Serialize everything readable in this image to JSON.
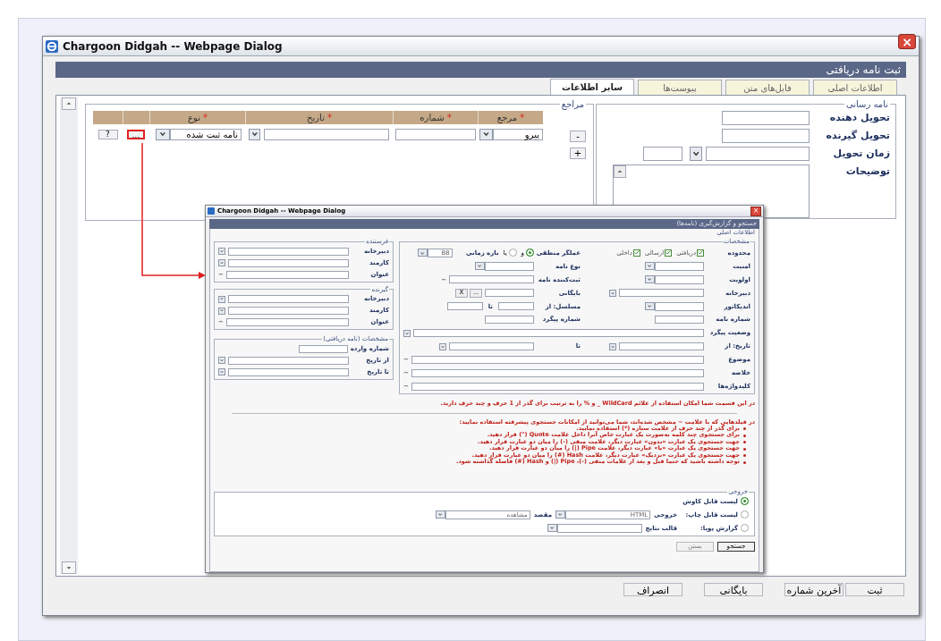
{
  "window": {
    "title": "Chargoon Didgah -- Webpage Dialog",
    "close": "×"
  },
  "header": "ثبت نامه دریافتی",
  "tabs": [
    {
      "label": "اطلاعات اصلی",
      "selected": false
    },
    {
      "label": "فایل‌های متن",
      "selected": false
    },
    {
      "label": "پیوست‌ها",
      "selected": false
    },
    {
      "label": "سایر اطلاعات",
      "selected": true
    }
  ],
  "delivery": {
    "legend": "نامه رسانی",
    "fields": [
      {
        "label": "تحویل دهنده",
        "kind": "text"
      },
      {
        "label": "تحویل گیرنده",
        "kind": "text"
      },
      {
        "label": "زمان تحویل",
        "kind": "datetime"
      },
      {
        "label": "توضیحات",
        "kind": "textarea"
      }
    ]
  },
  "references": {
    "legend": "مراجع",
    "remove": "-",
    "add": "+",
    "columns": [
      {
        "label": "مرجع",
        "mark": "*"
      },
      {
        "label": "شماره",
        "mark": "*"
      },
      {
        "label": "تاریخ",
        "mark": "*"
      },
      {
        "label": "نوع",
        "mark": "*"
      }
    ],
    "rows": [
      {
        "ref": "پیرو",
        "type": "نامه ثبت شده",
        "browse": "...",
        "browse_highlighted": true,
        "help": "?"
      }
    ]
  },
  "buttons": [
    "ثبت",
    "آخرین شماره",
    "بایگانی",
    "انصراف"
  ],
  "search_dialog": {
    "title": "Chargoon Didgah -- Webpage Dialog",
    "header": "جستجو و گزارش‌گیری (نامه‌ها)",
    "section": "اطلاعات اصلی",
    "main": {
      "legend": "مشخصات",
      "rows": [
        {
          "cells": [
            {
              "label": "محدوده",
              "kind": "checks",
              "options": [
                {
                  "label": "دریافتی",
                  "checked": true
                },
                {
                  "label": "ارسالی",
                  "checked": true
                },
                {
                  "label": "داخلی",
                  "checked": true
                }
              ]
            },
            {
              "label": "عملگر منطقی",
              "kind": "radios",
              "options": [
                {
                  "label": "و",
                  "selected": true
                },
                {
                  "label": "یا",
                  "selected": false
                }
              ]
            },
            {
              "label": "بازه زمانی",
              "kind": "select",
              "value": "88"
            }
          ]
        },
        {
          "cells": [
            {
              "label": "امنیت",
              "kind": "select"
            },
            {
              "label": "نوع نامه",
              "kind": "select"
            }
          ]
        },
        {
          "cells": [
            {
              "label": "اولویت",
              "kind": "select"
            },
            {
              "label": "ثبت‌کننده نامه",
              "kind": "wild",
              "wildcard": "~"
            }
          ]
        },
        {
          "cells": [
            {
              "label": "دبیرخانه",
              "kind": "combo"
            },
            {
              "label": "بایگانی",
              "kind": "archive",
              "browse": "...",
              "clear": "X"
            }
          ]
        },
        {
          "cells": [
            {
              "label": "اندیکاتور",
              "kind": "select"
            },
            {
              "label": "مسلسل: از",
              "kind": "range",
              "to": "تا"
            }
          ]
        },
        {
          "cells": [
            {
              "label": "شماره نامه",
              "kind": "text"
            },
            {
              "label": "شماره پیگرد",
              "kind": "text"
            }
          ]
        },
        {
          "cells": [
            {
              "label": "وضعیت پیگرد",
              "kind": "combo"
            }
          ]
        },
        {
          "cells": [
            {
              "label": "تاریخ: از",
              "kind": "combo"
            },
            {
              "label": "تا",
              "kind": "combo"
            }
          ]
        },
        {
          "cells": [
            {
              "label": "موضوع",
              "kind": "wild",
              "wildcard": "~"
            }
          ]
        },
        {
          "cells": [
            {
              "label": "خلاصه",
              "kind": "wild",
              "wildcard": "~"
            }
          ]
        },
        {
          "cells": [
            {
              "label": "کلیدواژه‌ها",
              "kind": "wild",
              "wildcard": "~"
            }
          ]
        }
      ]
    },
    "side": [
      {
        "legend": "فرستنده",
        "fields": [
          {
            "label": "دبیرخانه",
            "kind": "combo"
          },
          {
            "label": "کارمند",
            "kind": "combo"
          },
          {
            "label": "عنوان",
            "kind": "wild",
            "wildcard": "~"
          }
        ]
      },
      {
        "legend": "گیرنده",
        "fields": [
          {
            "label": "دبیرخانه",
            "kind": "combo"
          },
          {
            "label": "کارمند",
            "kind": "combo"
          },
          {
            "label": "عنوان",
            "kind": "wild",
            "wildcard": "~"
          }
        ]
      },
      {
        "legend": "مشخصات (نامه دریافتی)",
        "fields": [
          {
            "label": "شماره وارده",
            "kind": "text"
          },
          {
            "label": "از تاریخ",
            "kind": "combo"
          },
          {
            "label": "تا تاریخ",
            "kind": "combo"
          }
        ]
      }
    ],
    "wildcard_note": "در این قسمت شما امکان استفاده از علائم WildCard _ و % را به ترتیب برای گذر از 1 حرف و چند حرف دارید.",
    "help_intro": "در فیلدهایی که با علامت ~ مشخص شده‌اند، شما می‌توانید از امکانات جستجوی پیشرفته استفاده نمایید:",
    "help_items": [
      "برای گذر از چند حرف از علامت ستاره (*) استفاده نمایید.",
      "برای جستجوی چند کلمه به‌صورت یک عبارت خاص آنرا داخل علامت Quote (\") قرار دهید.",
      "جهت جستجوی یک عبارت «بدون» عبارت دیگر، علامت منفی (-) را میان دو عبارت قرار دهید.",
      "جهت جستجوی یک عبارت «یا» عبارت دیگر، علامت Pipe (|) را میان دو عبارت قرار دهید.",
      "جهت جستجوی یک عبارت «نزدیک» عبارت دیگر، علامت Hash (#) را میان دو عبارت قرار دهید.",
      "توجه داشته باشید که حتما قبل و بعد از علامات منفی (-)، Pipe (|) و Hash (#) فاصله گذاشته شود."
    ],
    "output": {
      "legend": "خروجی",
      "options": [
        {
          "label": "لیست قابل کاوش",
          "selected": true
        },
        {
          "label": "لیست قابل چاپ:",
          "selected": false,
          "fields": [
            {
              "label": "خروجی",
              "value": "HTML"
            },
            {
              "label": "مقصد",
              "value": "مشاهده"
            }
          ]
        },
        {
          "label": "گزارش پویا:",
          "selected": false,
          "fields": [
            {
              "label": "قالب نتایج"
            }
          ]
        }
      ]
    },
    "buttons": [
      "جستجو",
      "بستن"
    ]
  }
}
